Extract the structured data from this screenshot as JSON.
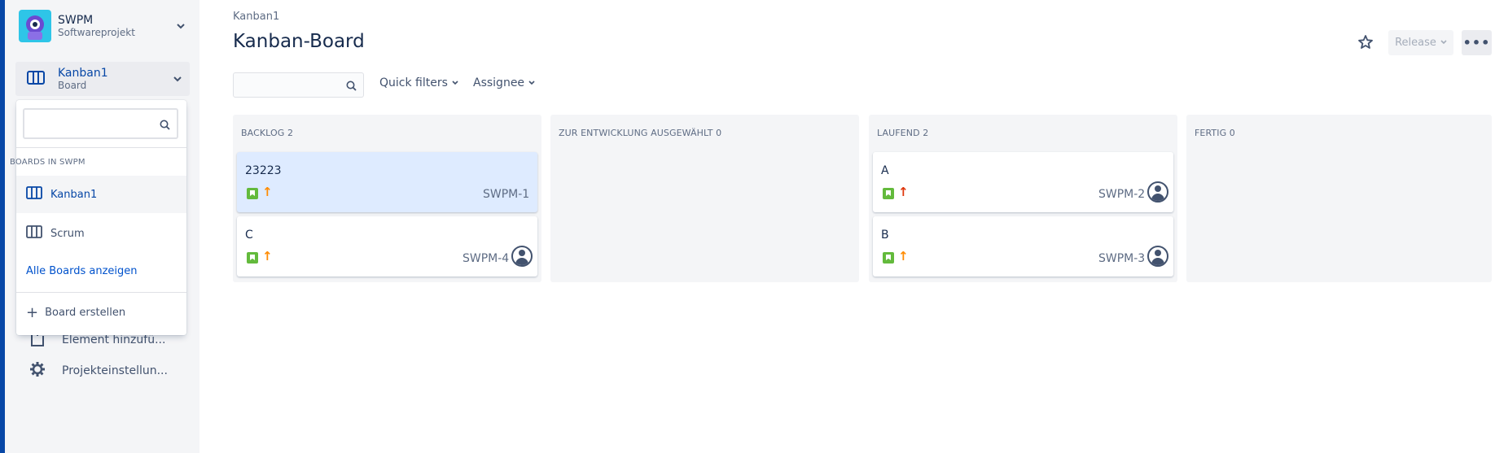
{
  "project": {
    "name": "SWPM",
    "subtitle": "Softwareprojekt"
  },
  "board_switcher": {
    "name": "Kanban1",
    "subtitle": "Board"
  },
  "dropdown": {
    "search_placeholder": "",
    "section_heading": "BOARDS IN SWPM",
    "boards": [
      {
        "label": "Kanban1",
        "active": true
      },
      {
        "label": "Scrum",
        "active": false
      }
    ],
    "show_all_label": "Alle Boards anzeigen",
    "create_label": "Board erstellen"
  },
  "sidebar_nav": [
    {
      "label": "Element hinzufü...",
      "icon": "add-page-icon"
    },
    {
      "label": "Projekteinstellun...",
      "icon": "gear-icon"
    }
  ],
  "breadcrumb": "Kanban1",
  "page_title": "Kanban-Board",
  "header_actions": {
    "release_label": "Release",
    "more_label": "•••"
  },
  "filters": {
    "search_placeholder": "",
    "quick_filters_label": "Quick filters",
    "assignee_label": "Assignee"
  },
  "columns": [
    {
      "heading": "BACKLOG 2",
      "cards": [
        {
          "title": "23223",
          "key": "SWPM-1",
          "priority": "medium",
          "highlight": true,
          "assignee": false
        },
        {
          "title": "C",
          "key": "SWPM-4",
          "priority": "medium",
          "highlight": false,
          "assignee": true
        }
      ]
    },
    {
      "heading": "ZUR ENTWICKLUNG AUSGEWÄHLT 0",
      "cards": []
    },
    {
      "heading": "LAUFEND 2",
      "cards": [
        {
          "title": "A",
          "key": "SWPM-2",
          "priority": "high",
          "highlight": false,
          "assignee": true
        },
        {
          "title": "B",
          "key": "SWPM-3",
          "priority": "medium",
          "highlight": false,
          "assignee": true
        }
      ]
    },
    {
      "heading": "FERTIG 0",
      "cards": []
    }
  ],
  "colors": {
    "sidebar_edge": "#0747a6",
    "story_type": "#63ba3c",
    "priority_medium": "#ff8b00",
    "priority_high": "#de350b",
    "link": "#0052cc",
    "highlight_card": "#deebff"
  }
}
